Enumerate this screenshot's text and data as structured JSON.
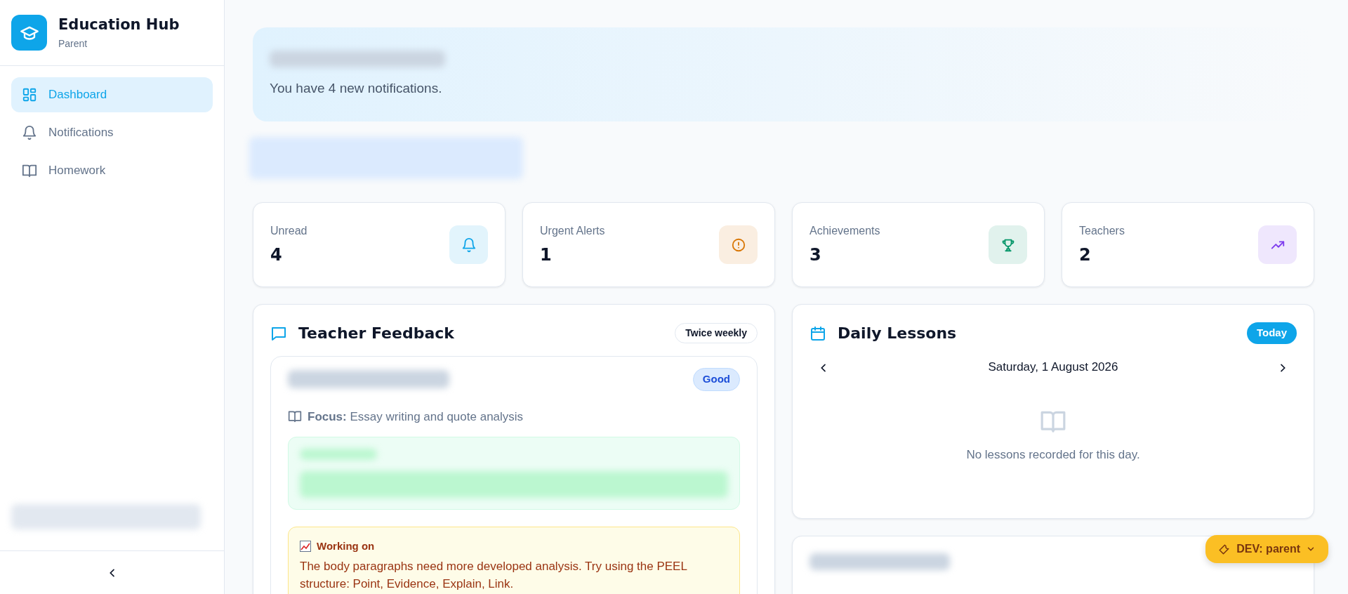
{
  "sidebar": {
    "app_name": "Education Hub",
    "role": "Parent",
    "nav": [
      {
        "label": "Dashboard",
        "selected": true
      },
      {
        "label": "Notifications",
        "selected": false
      },
      {
        "label": "Homework",
        "selected": false
      }
    ]
  },
  "banner": {
    "message": "You have 4 new notifications."
  },
  "stats": [
    {
      "label": "Unread",
      "value": "4",
      "color": "#0ea5e9"
    },
    {
      "label": "Urgent Alerts",
      "value": "1",
      "color": "#d97706"
    },
    {
      "label": "Achievements",
      "value": "3",
      "color": "#059669"
    },
    {
      "label": "Teachers",
      "value": "2",
      "color": "#7c3aed"
    }
  ],
  "feedback": {
    "title": "Teacher Feedback",
    "frequency": "Twice weekly",
    "entry": {
      "rating": "Good",
      "focus": "**Focus:** Essay writing and quote analysis",
      "working_on_title": "Working on",
      "working_on_text": "The body paragraphs need more developed analysis. Try using the PEEL structure: Point, Evidence, Explain, Link."
    }
  },
  "lessons": {
    "title": "Daily Lessons",
    "today_button": "Today",
    "date": "Saturday, 1 August 2026",
    "empty": "No lessons recorded for this day."
  },
  "dev_menu": {
    "label": "DEV: parent"
  }
}
